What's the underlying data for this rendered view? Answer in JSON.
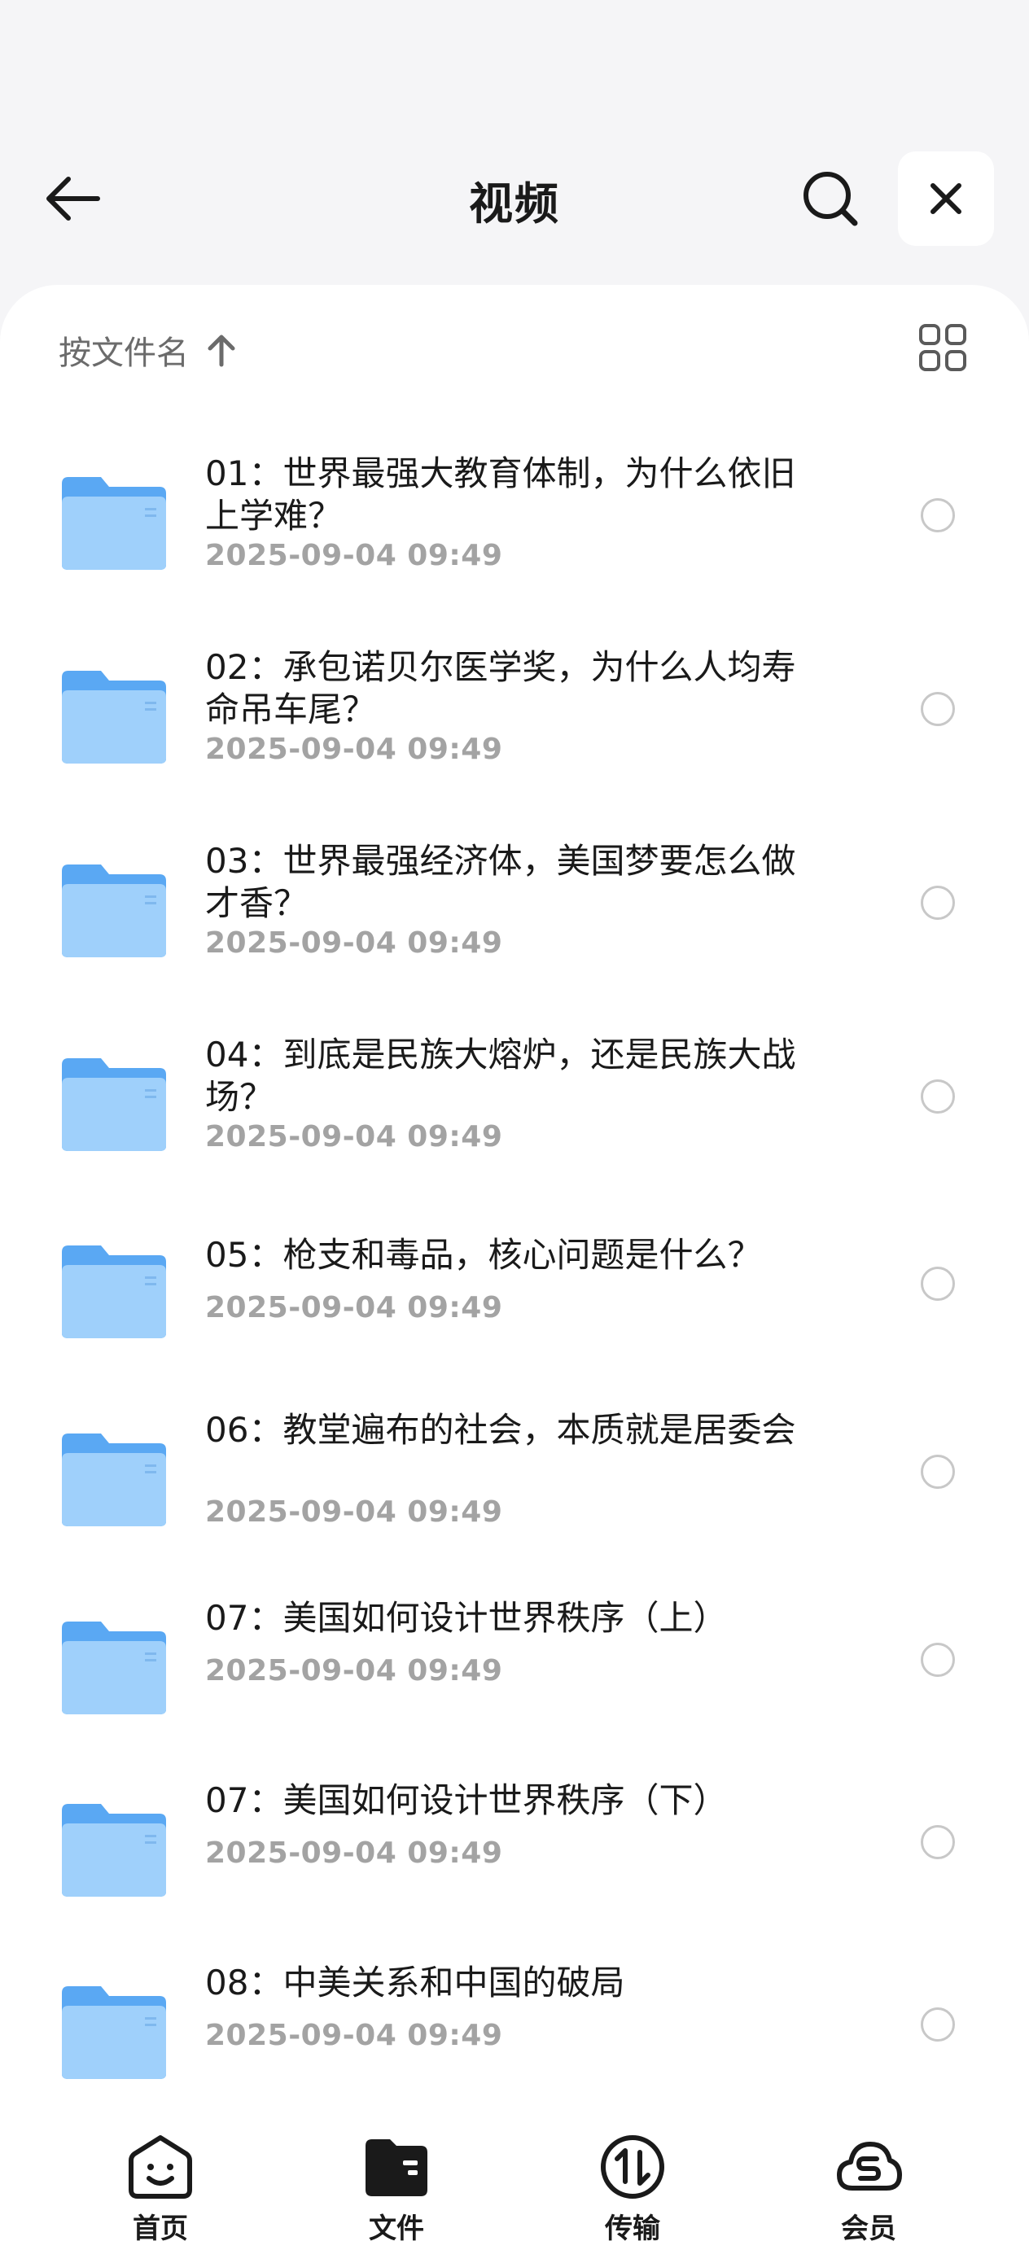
{
  "header": {
    "title": "视频"
  },
  "sort": {
    "label": "按文件名"
  },
  "files": [
    {
      "title": "01：世界最强大教育体制，为什么依旧上学难？",
      "date": "2025-09-04 09:49"
    },
    {
      "title": "02：承包诺贝尔医学奖，为什么人均寿命吊车尾？",
      "date": "2025-09-04 09:49"
    },
    {
      "title": "03：世界最强经济体，美国梦要怎么做才香？",
      "date": "2025-09-04 09:49"
    },
    {
      "title": "04：到底是民族大熔炉，还是民族大战场？",
      "date": "2025-09-04 09:49"
    },
    {
      "title": "05：枪支和毒品，核心问题是什么？",
      "date": "2025-09-04 09:49"
    },
    {
      "title": "06：教堂遍布的社会，本质就是居委会",
      "date": "2025-09-04 09:49"
    },
    {
      "title": "07：美国如何设计世界秩序（上）",
      "date": "2025-09-04 09:49"
    },
    {
      "title": "07：美国如何设计世界秩序（下）",
      "date": "2025-09-04 09:49"
    },
    {
      "title": "08：中美关系和中国的破局",
      "date": "2025-09-04 09:49"
    }
  ],
  "nav": [
    {
      "label": "首页",
      "icon": "smile-face-icon"
    },
    {
      "label": "文件",
      "icon": "folder-icon"
    },
    {
      "label": "传输",
      "icon": "transfer-icon"
    },
    {
      "label": "会员",
      "icon": "cloud-s-icon"
    }
  ],
  "colors": {
    "folder_light": "#9fd0fb",
    "folder_dark": "#5aa8f3",
    "background": "#f5f5f7"
  }
}
